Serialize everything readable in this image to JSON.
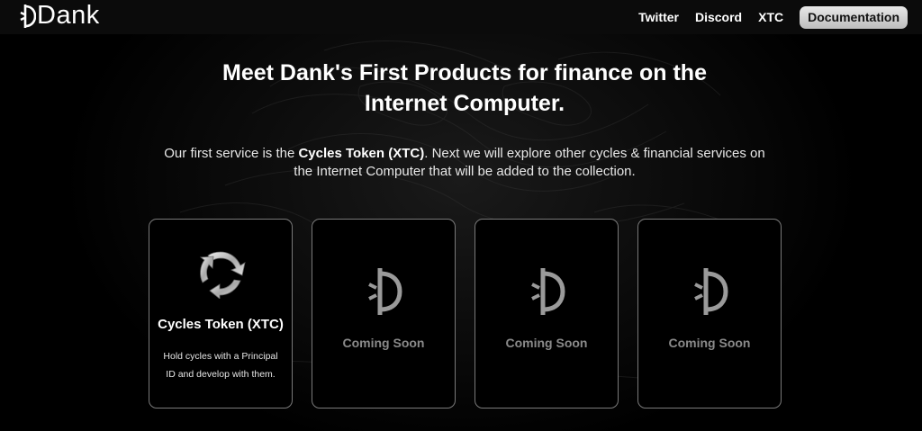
{
  "header": {
    "brand": "Dank",
    "nav": [
      {
        "label": "Twitter"
      },
      {
        "label": "Discord"
      },
      {
        "label": "XTC"
      }
    ],
    "cta_label": "Documentation"
  },
  "hero": {
    "title_line1": "Meet Dank's First Products for finance on the",
    "title_line2": "Internet Computer.",
    "sub_pre": "Our first service is the ",
    "sub_bold": "Cycles Token (XTC)",
    "sub_post_line1": ". Next we will explore other cycles & financial services on",
    "sub_line2": "the Internet Computer that will be added to the collection."
  },
  "products": [
    {
      "title": "Cycles Token (XTC)",
      "desc_line1": "Hold cycles with a Principal",
      "desc_line2": "ID and develop with them.",
      "icon": "cycles-icon"
    },
    {
      "status": "Coming Soon",
      "icon": "dank-logo-icon"
    },
    {
      "status": "Coming Soon",
      "icon": "dank-logo-icon"
    },
    {
      "status": "Coming Soon",
      "icon": "dank-logo-icon"
    }
  ]
}
